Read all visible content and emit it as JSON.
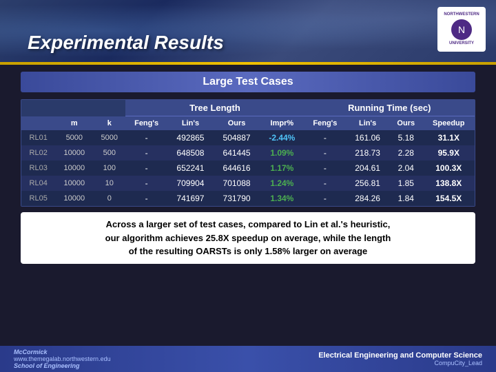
{
  "header": {
    "title": "Experimental Results",
    "logo_line1": "NORTHWESTERN",
    "logo_line2": "UNIVERSITY"
  },
  "section": {
    "title": "Large Test Cases"
  },
  "table": {
    "col_groups": [
      {
        "label": "",
        "colspan": 3
      },
      {
        "label": "Tree Length",
        "colspan": 4
      },
      {
        "label": "Running Time (sec)",
        "colspan": 4
      }
    ],
    "sub_headers": [
      "",
      "m",
      "k",
      "Feng's",
      "Lin's",
      "Ours",
      "Impr%",
      "Feng's",
      "Lin's",
      "Ours",
      "Speedup"
    ],
    "rows": [
      {
        "id": "RL01",
        "m": "5000",
        "k": "5000",
        "fengs_tree": "-",
        "lins_tree": "492865",
        "ours_tree": "504887",
        "impr": "-2.44%",
        "fengs_time": "-",
        "lins_time": "161.06",
        "ours_time": "5.18",
        "speedup": "31.1X"
      },
      {
        "id": "RL02",
        "m": "10000",
        "k": "500",
        "fengs_tree": "-",
        "lins_tree": "648508",
        "ours_tree": "641445",
        "impr": "1.09%",
        "fengs_time": "-",
        "lins_time": "218.73",
        "ours_time": "2.28",
        "speedup": "95.9X"
      },
      {
        "id": "RL03",
        "m": "10000",
        "k": "100",
        "fengs_tree": "-",
        "lins_tree": "652241",
        "ours_tree": "644616",
        "impr": "1.17%",
        "fengs_time": "-",
        "lins_time": "204.61",
        "ours_time": "2.04",
        "speedup": "100.3X"
      },
      {
        "id": "RL04",
        "m": "10000",
        "k": "10",
        "fengs_tree": "-",
        "lins_tree": "709904",
        "ours_tree": "701088",
        "impr": "1.24%",
        "fengs_time": "-",
        "lins_time": "256.81",
        "ours_time": "1.85",
        "speedup": "138.8X"
      },
      {
        "id": "RL05",
        "m": "10000",
        "k": "0",
        "fengs_tree": "-",
        "lins_tree": "741697",
        "ours_tree": "731790",
        "impr": "1.34%",
        "fengs_time": "-",
        "lins_time": "284.26",
        "ours_time": "1.84",
        "speedup": "154.5X"
      }
    ]
  },
  "bottom_text": {
    "line1": "Across a larger set of test cases, compared to Lin et al.'s heuristic,",
    "line2": "our algorithm achieves 25.8X speedup on average, while the length",
    "line3": "of the resulting OARSTs is only 1.58% larger on average"
  },
  "footer": {
    "logo_text": "McCormick",
    "sub_text": "School of Engineering",
    "url": "www.themegalab.northwestern.edu",
    "dept": "Electrical Engineering and Computer Science",
    "right_text": "CompuCity_Lead"
  }
}
